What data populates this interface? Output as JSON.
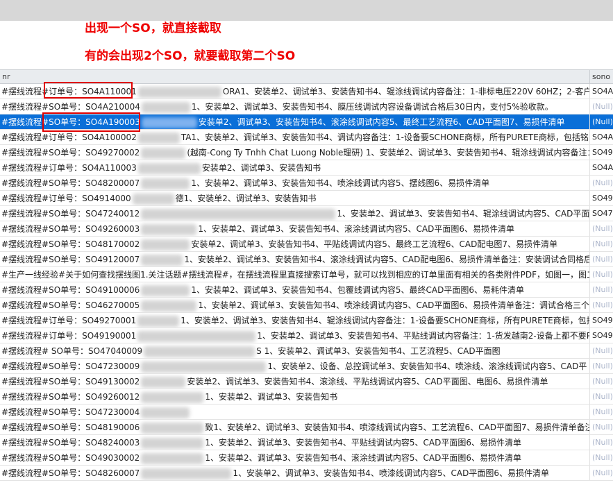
{
  "annotations": {
    "line1": "出现一个SO，就直接截取",
    "line2": "有的会出现2个SO，就要截取第二个SO"
  },
  "grid": {
    "columns": [
      "nr",
      "sono"
    ],
    "rows": [
      {
        "pre": "#摆线流程#订单号：SO4A110001",
        "blur": 120,
        "post": "ORA1、安装单2、调试单3、安装告知书4、辊涂线调试内容备注：1-非标电压220V 60HZ；2-客户",
        "sono": "SO4A",
        "null": false,
        "sel": false
      },
      {
        "pre": "#摆线流程#SO单号：SO4A210004",
        "blur": 70,
        "post": "1、安装单2、调试单3、安装告知书4、膜压线调试内容设备调试合格后30日内，支付5%验收款。",
        "sono": "(Null)",
        "null": true,
        "sel": false
      },
      {
        "pre": "#摆线流程#SO单号：SO4A190003",
        "blur": 80,
        "post": "安装单2、调试单3、安装告知书4、滚涂线调试内容5、最终工艺流程6、CAD平面图7、易损件清单",
        "sono": "(Null)",
        "null": true,
        "sel": true
      },
      {
        "pre": "#摆线流程#订单号：SO4A100002",
        "blur": 60,
        "post": "TA1、安装单2、调试单3、安装告知书4、调试内容备注：1-设备要SCHONE商标，所有PURETE商标，包括铭",
        "sono": "SO4A",
        "null": false,
        "sel": false
      },
      {
        "pre": "#摆线流程#SO单号：SO49270002",
        "blur": 64,
        "post": "(越南-Cong Ty Tnhh Chat Luong Noble理研) 1、安装单2、调试单3、安装告知书4、辊涂线调试内容备注：调",
        "sono": "SO49",
        "null": false,
        "sel": false
      },
      {
        "pre": "#摆线流程#订单号：SO4A110003",
        "blur": 90,
        "post": "安装单2、调试单3、安装告知书",
        "sono": "SO4A",
        "null": false,
        "sel": false
      },
      {
        "pre": "#摆线流程#SO单号：SO48200007",
        "blur": 70,
        "post": "1、安装单2、调试单3、安装告知书4、喷涂线调试内容5、摆线图6、易损件清单",
        "sono": "(Null)",
        "null": true,
        "sel": false
      },
      {
        "pre": "#摆线流程#订单号：SO4914000",
        "blur": 60,
        "post": "德1、安装单2、调试单3、安装告知书",
        "sono": "SO49",
        "null": false,
        "sel": false
      },
      {
        "pre": "#摆线流程#SO单号：SO47240012",
        "blur": 280,
        "post": "1、安装单2、调试单3、安装告知书4、辊涂线调试内容5、CAD平面图6",
        "sono": "SO47",
        "null": false,
        "sel": false
      },
      {
        "pre": "#摆线流程#SO单号：SO49260003",
        "blur": 80,
        "post": "1、安装单2、调试单3、安装告知书4、滚涂线调试内容5、CAD平面图6、易损件清单",
        "sono": "(Null)",
        "null": true,
        "sel": false
      },
      {
        "pre": "#摆线流程#SO单号：SO48170002",
        "blur": 70,
        "post": "安装单2、调试单3、安装告知书4、平贴线调试内容5、最终工艺流程6、CAD配电图7、易损件清单",
        "sono": "(Null)",
        "null": true,
        "sel": false
      },
      {
        "pre": "#摆线流程#SO单号：SO49120007",
        "blur": 60,
        "post": "1、安装单2、调试单3、安装告知书4、滚涂线调试内容5、CAD配电图6、易损件清单备注：安装调试合同格后5",
        "sono": "(Null)",
        "null": true,
        "sel": false
      },
      {
        "pre": "#生产一线经验#关于如何查找摆线图1.关注话题#摆线流程#，在摆线流程里直接搜索订单号，就可以找到相应的订单里面有相关的各类附件PDF，如图一，图二2",
        "blur": 0,
        "post": "",
        "sono": "(Null)",
        "null": true,
        "sel": false
      },
      {
        "pre": "#摆线流程#SO单号：SO49100006",
        "blur": 70,
        "post": "1、安装单2、调试单3、安装告知书4、包覆线调试内容5、最终CAD平面图6、易耗件清单",
        "sono": "(Null)",
        "null": true,
        "sel": false
      },
      {
        "pre": "#摆线流程#SO单号：SO46270005",
        "blur": 80,
        "post": "1、安装单2、调试单3、安装告知书4、喷涂线调试内容5、CAD平面图6、易损件清单备注：调试合格三个月",
        "sono": "(Null)",
        "null": true,
        "sel": false
      },
      {
        "pre": "#摆线流程#订单号：SO49270001",
        "blur": 60,
        "post": "1、安装单2、调试单3、安装告知书4、辊涂线调试内容备注：1-设备要SCHONE商标，所有PURETE商标，包括铭",
        "sono": "SO49",
        "null": false,
        "sel": false
      },
      {
        "pre": "#摆线流程#订单号：SO49190001",
        "blur": 170,
        "post": "1、安装单2、调试单3、安装告知书4、平贴线调试内容备注：1-货发越南2-设备上都不要P",
        "sono": "SO49",
        "null": false,
        "sel": false
      },
      {
        "pre": "#摆线流程# SO单号：SO47040009",
        "blur": 160,
        "post": "S 1、安装单2、调试单3、安装告知书4、工艺流程5、CAD平面图",
        "sono": "(Null)",
        "null": true,
        "sel": false
      },
      {
        "pre": "#摆线流程#SO单号：SO47230009",
        "blur": 180,
        "post": "1、安装单2、设备、总控调试单3、安装告知书4、喷涂线、滚涂线调试内容5、CAD平",
        "sono": "(Null)",
        "null": true,
        "sel": false
      },
      {
        "pre": "#摆线流程#SO单号：SO49130002",
        "blur": 64,
        "post": "安装单2、调试单3、安装告知书4、滚涂线、平贴线调试内容5、CAD平面图、电图6、易损件清单",
        "sono": "(Null)",
        "null": true,
        "sel": false
      },
      {
        "pre": "#摆线流程#SO单号：SO49260012",
        "blur": 90,
        "post": "1、安装单2、调试单3、安装告知书",
        "sono": "(Null)",
        "null": true,
        "sel": false
      },
      {
        "pre": "#摆线流程#SO单号：SO47230004",
        "blur": 70,
        "post": "",
        "sono": "(Null)",
        "null": true,
        "sel": false
      },
      {
        "pre": "#摆线流程#SO单号：SO48190006",
        "blur": 90,
        "post": "致1、安装单2、调试单3、安装告知书4、喷漆线调试内容5、工艺流程6、CAD平面图7、易损件清单备注：已收",
        "sono": "(Null)",
        "null": true,
        "sel": false
      },
      {
        "pre": "#摆线流程#SO单号：SO48240003",
        "blur": 90,
        "post": "1、安装单2、调试单3、安装告知书4、平贴线调试内容5、CAD平面图6、易损件清单",
        "sono": "(Null)",
        "null": true,
        "sel": false
      },
      {
        "pre": "#摆线流程#SO单号：SO49030002",
        "blur": 90,
        "post": "1、安装单2、调试单3、安装告知书4、滚涂线调试内容5、CAD平面图6、易损件清单",
        "sono": "(Null)",
        "null": true,
        "sel": false
      },
      {
        "pre": "#摆线流程#SO单号：SO48260007",
        "blur": 130,
        "post": "1、安装单2、调试单3、安装告知书4、喷漆线调试内容5、CAD平面图6、易损件清单",
        "sono": "(Null)",
        "null": true,
        "sel": false
      }
    ]
  }
}
